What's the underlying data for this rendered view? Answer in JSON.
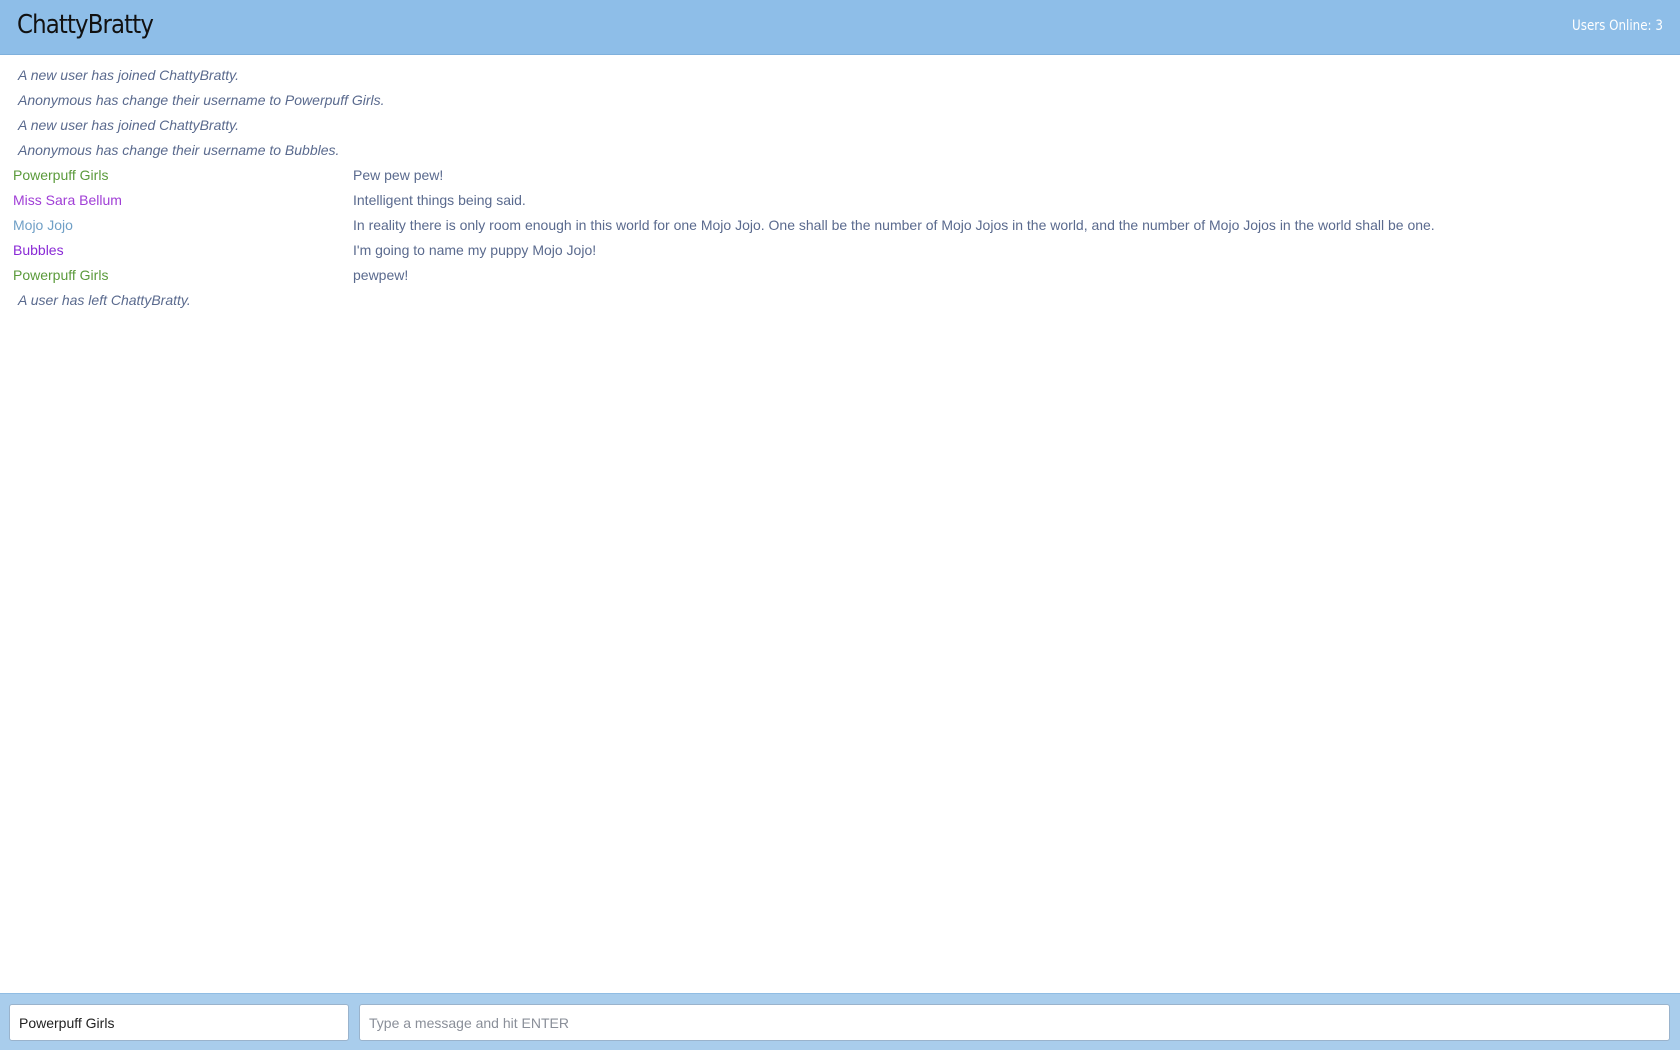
{
  "navbar": {
    "brand": "ChattyBratty",
    "users_online": "Users Online: 3"
  },
  "messages": [
    {
      "type": "notification",
      "text": "A new user has joined ChattyBratty."
    },
    {
      "type": "notification",
      "text": "Anonymous has change their username to Powerpuff Girls."
    },
    {
      "type": "notification",
      "text": "A new user has joined ChattyBratty."
    },
    {
      "type": "notification",
      "text": "Anonymous has change their username to Bubbles."
    },
    {
      "type": "message",
      "username": "Powerpuff Girls",
      "color": "#5a9a3a",
      "content": "Pew pew pew!"
    },
    {
      "type": "message",
      "username": "Miss Sara Bellum",
      "color": "#a03ed6",
      "content": "Intelligent things being said."
    },
    {
      "type": "message",
      "username": "Mojo Jojo",
      "color": "#6f9fc6",
      "content": "In reality there is only room enough in this world for one Mojo Jojo. One shall be the number of Mojo Jojos in the world, and the number of Mojo Jojos in the world shall be one."
    },
    {
      "type": "message",
      "username": "Bubbles",
      "color": "#8a2ad6",
      "content": "I'm going to name my puppy Mojo Jojo!"
    },
    {
      "type": "message",
      "username": "Powerpuff Girls",
      "color": "#5a9a3a",
      "content": "pewpew!"
    },
    {
      "type": "notification",
      "text": "A user has left ChattyBratty."
    }
  ],
  "footer": {
    "username_value": "Powerpuff Girls",
    "message_value": "",
    "message_placeholder": "Type a message and hit ENTER"
  }
}
